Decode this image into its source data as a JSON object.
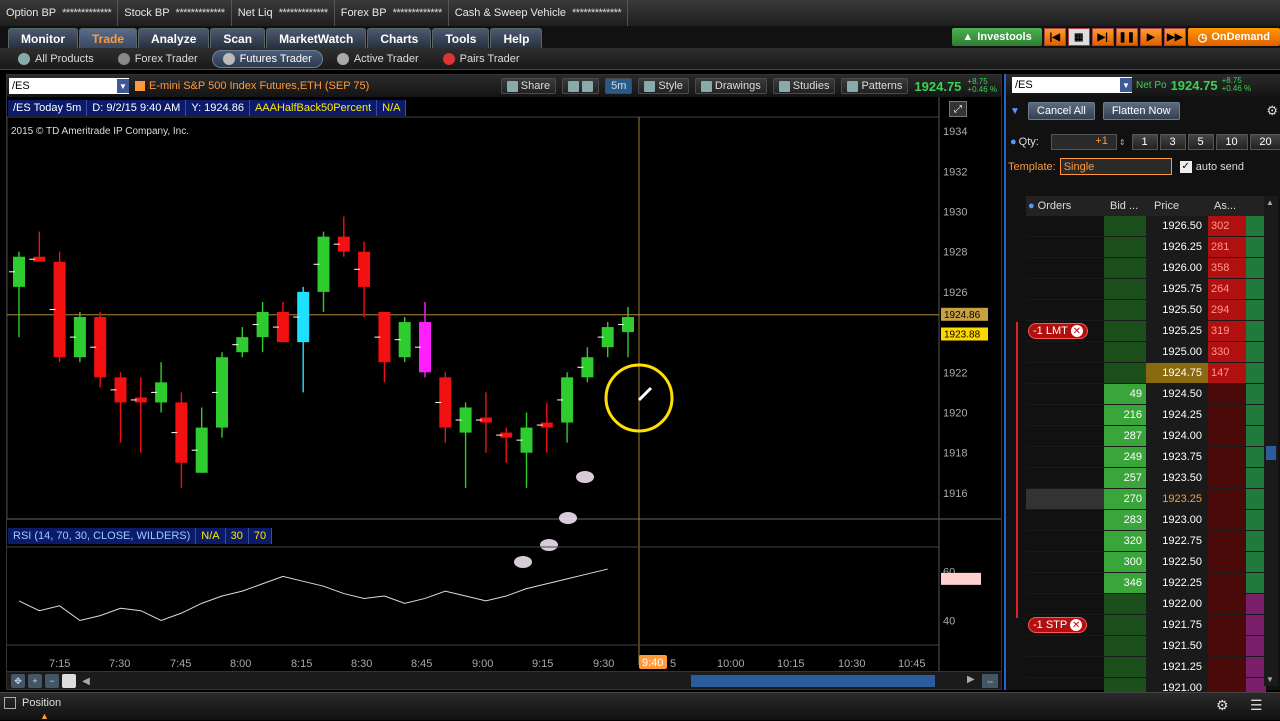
{
  "topbar": [
    {
      "label": "Option BP",
      "value": "*************"
    },
    {
      "label": "Stock BP",
      "value": "*************"
    },
    {
      "label": "Net Liq",
      "value": "*************"
    },
    {
      "label": "Forex BP",
      "value": "*************"
    },
    {
      "label": "Cash & Sweep Vehicle",
      "value": "*************"
    }
  ],
  "nav": {
    "tabs": [
      "Monitor",
      "Trade",
      "Analyze",
      "Scan",
      "MarketWatch",
      "Charts",
      "Tools",
      "Help"
    ],
    "active": "Trade",
    "investools": "Investools",
    "ondemand": "OnDemand"
  },
  "subnav": [
    {
      "label": "All Products",
      "active": false,
      "color": "#9aa"
    },
    {
      "label": "Forex Trader",
      "active": false,
      "color": "#999"
    },
    {
      "label": "Futures Trader",
      "active": true,
      "color": "#bbb"
    },
    {
      "label": "Active Trader",
      "active": false,
      "color": "#aaa"
    },
    {
      "label": "Pairs Trader",
      "active": false,
      "color": "#d33"
    }
  ],
  "chart": {
    "symbol": "/ES",
    "description": "E-mini S&P 500 Index Futures,ETH (SEP 75)",
    "share": "Share",
    "aggregation": "5m",
    "style": "Style",
    "drawings": "Drawings",
    "studies": "Studies",
    "patterns": "Patterns",
    "last": "1924.75",
    "change_abs": "+8.75",
    "change_pct": "+0.46 %",
    "study_row": [
      "/ES Today 5m",
      "D: 9/2/15 9:40 AM",
      "Y: 1924.86",
      "AAAHalfBack50Percent",
      "N/A"
    ],
    "copyright": "2015 © TD Ameritrade IP Company, Inc.",
    "price_axis": [
      "1934",
      "1932",
      "1930",
      "1928",
      "1926",
      "1922",
      "1920",
      "1918",
      "1916"
    ],
    "price_tags": {
      "cursor": "1924.86",
      "last": "1923.88"
    },
    "time_axis": [
      "7:15",
      "7:30",
      "7:45",
      "8:00",
      "8:15",
      "8:30",
      "8:45",
      "9:00",
      "9:15",
      "9:30",
      "10:00",
      "10:15",
      "10:30",
      "10:45"
    ],
    "time_cursor": "9:40",
    "time_partial": "5",
    "rsi_row": [
      "RSI (14, 70, 30, CLOSE, WILDERS)",
      "N/A",
      "30",
      "70"
    ],
    "rsi_axis": [
      "60",
      "40"
    ]
  },
  "chart_data": {
    "type": "candlestick",
    "x": [
      "7:10",
      "7:15",
      "7:20",
      "7:25",
      "7:30",
      "7:35",
      "7:40",
      "7:45",
      "7:50",
      "7:55",
      "8:00",
      "8:05",
      "8:10",
      "8:15",
      "8:20",
      "8:25",
      "8:30",
      "8:35",
      "8:40",
      "8:45",
      "8:50",
      "8:55",
      "9:00",
      "9:05",
      "9:10",
      "9:15",
      "9:20",
      "9:25",
      "9:30",
      "9:35"
    ],
    "series": [
      {
        "open": 1926.25,
        "high": 1928,
        "low": 1923.75,
        "close": 1927.75,
        "color": "green"
      },
      {
        "open": 1927.75,
        "high": 1929,
        "low": 1927.5,
        "close": 1927.5,
        "color": "red"
      },
      {
        "open": 1927.5,
        "high": 1928,
        "low": 1922.5,
        "close": 1922.75,
        "color": "red"
      },
      {
        "open": 1922.75,
        "high": 1925,
        "low": 1922.5,
        "close": 1924.75,
        "color": "green"
      },
      {
        "open": 1924.75,
        "high": 1925,
        "low": 1921.25,
        "close": 1921.75,
        "color": "red"
      },
      {
        "open": 1921.75,
        "high": 1922,
        "low": 1918.5,
        "close": 1920.5,
        "color": "red"
      },
      {
        "open": 1920.5,
        "high": 1921.75,
        "low": 1918,
        "close": 1920.75,
        "color": "red"
      },
      {
        "open": 1920.5,
        "high": 1922.5,
        "low": 1920,
        "close": 1921.5,
        "color": "green"
      },
      {
        "open": 1920.5,
        "high": 1921,
        "low": 1916.25,
        "close": 1917.5,
        "color": "red"
      },
      {
        "open": 1917,
        "high": 1920.25,
        "low": 1917,
        "close": 1919.25,
        "color": "green"
      },
      {
        "open": 1919.25,
        "high": 1923,
        "low": 1918.75,
        "close": 1922.75,
        "color": "green"
      },
      {
        "open": 1923,
        "high": 1924.25,
        "low": 1922.75,
        "close": 1923.75,
        "color": "green"
      },
      {
        "open": 1923.75,
        "high": 1925.5,
        "low": 1923,
        "close": 1925,
        "color": "green"
      },
      {
        "open": 1925,
        "high": 1925.5,
        "low": 1923.5,
        "close": 1923.5,
        "color": "red"
      },
      {
        "open": 1923.5,
        "high": 1926.25,
        "low": 1921,
        "close": 1926,
        "color": "cyan"
      },
      {
        "open": 1926,
        "high": 1929,
        "low": 1925,
        "close": 1928.75,
        "color": "green"
      },
      {
        "open": 1928.75,
        "high": 1929.75,
        "low": 1927.75,
        "close": 1928,
        "color": "red"
      },
      {
        "open": 1928,
        "high": 1928.5,
        "low": 1924.75,
        "close": 1926.25,
        "color": "red"
      },
      {
        "open": 1925,
        "high": 1925,
        "low": 1921.5,
        "close": 1922.5,
        "color": "red"
      },
      {
        "open": 1922.75,
        "high": 1924.75,
        "low": 1922.5,
        "close": 1924.5,
        "color": "green"
      },
      {
        "open": 1924.5,
        "high": 1925.5,
        "low": 1921.75,
        "close": 1922,
        "color": "magenta"
      },
      {
        "open": 1921.75,
        "high": 1922,
        "low": 1918.5,
        "close": 1919.25,
        "color": "red"
      },
      {
        "open": 1919,
        "high": 1920.5,
        "low": 1916.25,
        "close": 1920.25,
        "color": "green"
      },
      {
        "open": 1919.75,
        "high": 1921,
        "low": 1918,
        "close": 1919.5,
        "color": "red"
      },
      {
        "open": 1919,
        "high": 1919.25,
        "low": 1917.5,
        "close": 1918.75,
        "color": "red"
      },
      {
        "open": 1918,
        "high": 1920,
        "low": 1916.25,
        "close": 1919.25,
        "color": "green"
      },
      {
        "open": 1919.5,
        "high": 1920.5,
        "low": 1918,
        "close": 1919.25,
        "color": "red"
      },
      {
        "open": 1919.5,
        "high": 1922,
        "low": 1918.5,
        "close": 1921.75,
        "color": "green"
      },
      {
        "open": 1921.75,
        "high": 1923.25,
        "low": 1921.5,
        "close": 1922.75,
        "color": "green"
      },
      {
        "open": 1923.25,
        "high": 1924.5,
        "low": 1922.75,
        "close": 1924.25,
        "color": "green"
      },
      {
        "open": 1924,
        "high": 1925.25,
        "low": 1922.75,
        "close": 1924.75,
        "color": "green"
      }
    ],
    "rsi": [
      48,
      44,
      46,
      40,
      42,
      45,
      44,
      40,
      43,
      47,
      50,
      52,
      55,
      58,
      56,
      54,
      51,
      49,
      50,
      47,
      49,
      52,
      50,
      48,
      50,
      53,
      55,
      57,
      59,
      61
    ],
    "ylim": [
      1915,
      1935
    ],
    "rsi_lim": [
      30,
      70
    ]
  },
  "trade": {
    "symbol": "/ES",
    "netpos_label": "Net Po",
    "last": "1924.75",
    "change_abs": "+8.75",
    "change_pct": "+0.46 %",
    "cancel_all": "Cancel All",
    "flatten_now": "Flatten Now",
    "qty_label": "Qty:",
    "qty_value": "+1",
    "qty_presets": [
      "1",
      "3",
      "5",
      "10",
      "20"
    ],
    "template_label": "Template:",
    "template_value": "Single",
    "auto_send": "auto send",
    "columns": [
      "Orders",
      "Bid ...",
      "Price",
      "As..."
    ],
    "rows": [
      {
        "price": "1926.50",
        "bid": "",
        "ask": "302",
        "order": ""
      },
      {
        "price": "1926.25",
        "bid": "",
        "ask": "281",
        "order": ""
      },
      {
        "price": "1926.00",
        "bid": "",
        "ask": "358",
        "order": ""
      },
      {
        "price": "1925.75",
        "bid": "",
        "ask": "264",
        "order": ""
      },
      {
        "price": "1925.50",
        "bid": "",
        "ask": "294",
        "order": ""
      },
      {
        "price": "1925.25",
        "bid": "",
        "ask": "319",
        "order": "-1 LMT"
      },
      {
        "price": "1925.00",
        "bid": "",
        "ask": "330",
        "order": ""
      },
      {
        "price": "1924.75",
        "bid": "",
        "ask": "147",
        "order": "",
        "last": true
      },
      {
        "price": "1924.50",
        "bid": "49",
        "ask": "",
        "order": ""
      },
      {
        "price": "1924.25",
        "bid": "216",
        "ask": "",
        "order": ""
      },
      {
        "price": "1924.00",
        "bid": "287",
        "ask": "",
        "order": ""
      },
      {
        "price": "1923.75",
        "bid": "249",
        "ask": "",
        "order": ""
      },
      {
        "price": "1923.50",
        "bid": "257",
        "ask": "",
        "order": ""
      },
      {
        "price": "1923.25",
        "bid": "270",
        "ask": "",
        "order": "",
        "current": true
      },
      {
        "price": "1923.00",
        "bid": "283",
        "ask": "",
        "order": ""
      },
      {
        "price": "1922.75",
        "bid": "320",
        "ask": "",
        "order": ""
      },
      {
        "price": "1922.50",
        "bid": "300",
        "ask": "",
        "order": ""
      },
      {
        "price": "1922.25",
        "bid": "346",
        "ask": "",
        "order": ""
      },
      {
        "price": "1922.00",
        "bid": "",
        "ask": "",
        "order": ""
      },
      {
        "price": "1921.75",
        "bid": "",
        "ask": "",
        "order": "-1 STP"
      },
      {
        "price": "1921.50",
        "bid": "",
        "ask": "",
        "order": ""
      },
      {
        "price": "1921.25",
        "bid": "",
        "ask": "",
        "order": ""
      },
      {
        "price": "1921.00",
        "bid": "",
        "ask": "",
        "order": ""
      }
    ]
  },
  "bottom": {
    "position": "Position"
  }
}
